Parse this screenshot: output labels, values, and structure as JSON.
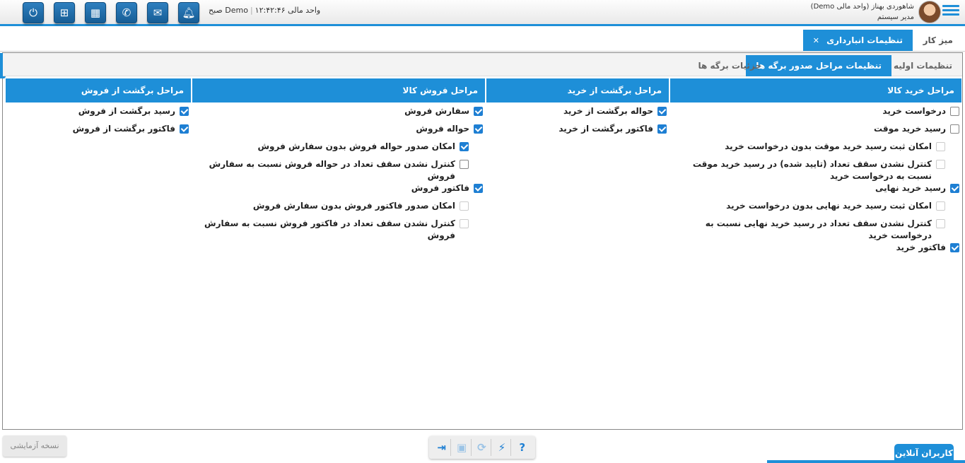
{
  "topbar": {
    "user_name": "شاهوردی بهناز (واحد مالی Demo)",
    "user_role": "مدیر سیستم",
    "unit": "واحد مالی Demo",
    "time": "۱۲:۴۲:۴۶ صبح",
    "icons": [
      "power-icon",
      "org-chart-icon",
      "calculator-icon",
      "phone-icon",
      "mail-icon",
      "bell-icon"
    ]
  },
  "main_tabs": {
    "desk": "میز کار",
    "active": "تنظیمات انبارداری",
    "close_glyph": "✕"
  },
  "sub_tabs": {
    "t1": "تنظیمات اولیه",
    "t2": "تنظیمات مراحل صدور برگه ها",
    "t3": "جزئیات برگه ها"
  },
  "columns": [
    {
      "title": "مراحل خرید کالا",
      "items": [
        {
          "label": "درخواست خرید",
          "checked": false,
          "sub": false,
          "disabled": false
        },
        {
          "label": "رسید خرید موقت",
          "checked": false,
          "sub": false,
          "disabled": false
        },
        {
          "label": "امکان ثبت رسید خرید موقت بدون درخواست خرید",
          "checked": false,
          "sub": true,
          "disabled": true
        },
        {
          "label": "کنترل نشدن سقف تعداد (تایید شده) در رسید خرید موقت نسبت به درخواست خرید",
          "checked": false,
          "sub": true,
          "disabled": true
        },
        {
          "label": "رسید خرید نهایی",
          "checked": true,
          "sub": false,
          "disabled": false
        },
        {
          "label": "امکان ثبت رسید خرید نهایی بدون درخواست خرید",
          "checked": false,
          "sub": true,
          "disabled": true
        },
        {
          "label": "کنترل نشدن سقف تعداد در رسید خرید نهایی نسبت به درخواست خرید",
          "checked": false,
          "sub": true,
          "disabled": true
        },
        {
          "label": "فاکتور خرید",
          "checked": true,
          "sub": false,
          "disabled": false
        }
      ]
    },
    {
      "title": "مراحل برگشت از خرید",
      "items": [
        {
          "label": "حواله برگشت از خرید",
          "checked": true,
          "sub": false,
          "disabled": false
        },
        {
          "label": "فاکتور برگشت از خرید",
          "checked": true,
          "sub": false,
          "disabled": false
        }
      ]
    },
    {
      "title": "مراحل فروش کالا",
      "items": [
        {
          "label": "سفارش فروش",
          "checked": true,
          "sub": false,
          "disabled": false
        },
        {
          "label": "حواله فروش",
          "checked": true,
          "sub": false,
          "disabled": false
        },
        {
          "label": "امکان صدور حواله فروش بدون سفارش فروش",
          "checked": true,
          "sub": true,
          "disabled": false
        },
        {
          "label": "کنترل نشدن سقف تعداد در حواله فروش نسبت به سفارش فروش",
          "checked": false,
          "sub": true,
          "disabled": false
        },
        {
          "label": "فاکتور فروش",
          "checked": true,
          "sub": false,
          "disabled": false
        },
        {
          "label": "امکان صدور فاکتور فروش بدون سفارش فروش",
          "checked": false,
          "sub": true,
          "disabled": true
        },
        {
          "label": "کنترل نشدن سقف تعداد در فاکتور فروش نسبت به سفارش فروش",
          "checked": false,
          "sub": true,
          "disabled": true
        }
      ]
    },
    {
      "title": "مراحل برگشت از فروش",
      "items": [
        {
          "label": "رسید برگشت از فروش",
          "checked": true,
          "sub": false,
          "disabled": false
        },
        {
          "label": "فاکتور برگشت از فروش",
          "checked": true,
          "sub": false,
          "disabled": false
        }
      ]
    }
  ],
  "footer": {
    "demo_label": "نسخه آزمایشی",
    "toolbar": [
      {
        "name": "help-icon",
        "glyph": "?"
      },
      {
        "name": "lightning-icon",
        "glyph": "⚡"
      },
      {
        "name": "refresh-icon",
        "glyph": "⟳"
      },
      {
        "name": "save-icon",
        "glyph": "▣"
      },
      {
        "name": "exit-icon",
        "glyph": "⇥"
      }
    ],
    "online_users": "کاربران آنلاین"
  },
  "colors": {
    "accent": "#1e8fd8",
    "checkbox": "#1e7fd3"
  }
}
